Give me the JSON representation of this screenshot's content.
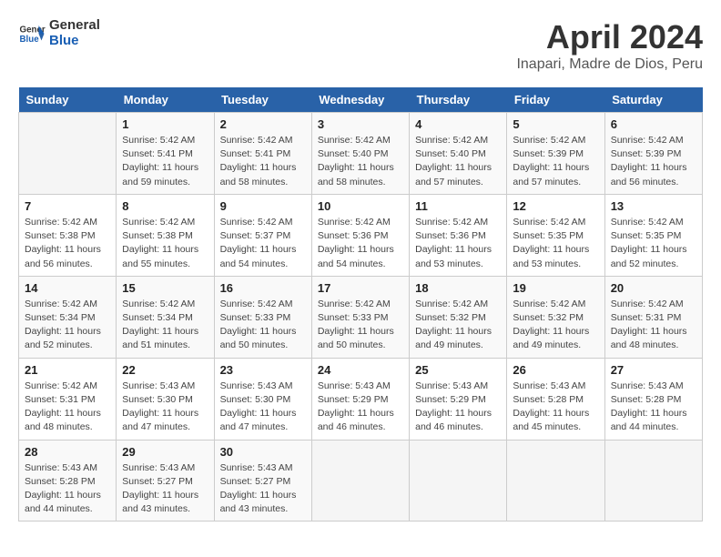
{
  "header": {
    "logo_line1": "General",
    "logo_line2": "Blue",
    "title": "April 2024",
    "subtitle": "Inapari, Madre de Dios, Peru"
  },
  "calendar": {
    "days_of_week": [
      "Sunday",
      "Monday",
      "Tuesday",
      "Wednesday",
      "Thursday",
      "Friday",
      "Saturday"
    ],
    "weeks": [
      [
        {
          "day": "",
          "info": ""
        },
        {
          "day": "1",
          "info": "Sunrise: 5:42 AM\nSunset: 5:41 PM\nDaylight: 11 hours\nand 59 minutes."
        },
        {
          "day": "2",
          "info": "Sunrise: 5:42 AM\nSunset: 5:41 PM\nDaylight: 11 hours\nand 58 minutes."
        },
        {
          "day": "3",
          "info": "Sunrise: 5:42 AM\nSunset: 5:40 PM\nDaylight: 11 hours\nand 58 minutes."
        },
        {
          "day": "4",
          "info": "Sunrise: 5:42 AM\nSunset: 5:40 PM\nDaylight: 11 hours\nand 57 minutes."
        },
        {
          "day": "5",
          "info": "Sunrise: 5:42 AM\nSunset: 5:39 PM\nDaylight: 11 hours\nand 57 minutes."
        },
        {
          "day": "6",
          "info": "Sunrise: 5:42 AM\nSunset: 5:39 PM\nDaylight: 11 hours\nand 56 minutes."
        }
      ],
      [
        {
          "day": "7",
          "info": "Sunrise: 5:42 AM\nSunset: 5:38 PM\nDaylight: 11 hours\nand 56 minutes."
        },
        {
          "day": "8",
          "info": "Sunrise: 5:42 AM\nSunset: 5:38 PM\nDaylight: 11 hours\nand 55 minutes."
        },
        {
          "day": "9",
          "info": "Sunrise: 5:42 AM\nSunset: 5:37 PM\nDaylight: 11 hours\nand 54 minutes."
        },
        {
          "day": "10",
          "info": "Sunrise: 5:42 AM\nSunset: 5:36 PM\nDaylight: 11 hours\nand 54 minutes."
        },
        {
          "day": "11",
          "info": "Sunrise: 5:42 AM\nSunset: 5:36 PM\nDaylight: 11 hours\nand 53 minutes."
        },
        {
          "day": "12",
          "info": "Sunrise: 5:42 AM\nSunset: 5:35 PM\nDaylight: 11 hours\nand 53 minutes."
        },
        {
          "day": "13",
          "info": "Sunrise: 5:42 AM\nSunset: 5:35 PM\nDaylight: 11 hours\nand 52 minutes."
        }
      ],
      [
        {
          "day": "14",
          "info": "Sunrise: 5:42 AM\nSunset: 5:34 PM\nDaylight: 11 hours\nand 52 minutes."
        },
        {
          "day": "15",
          "info": "Sunrise: 5:42 AM\nSunset: 5:34 PM\nDaylight: 11 hours\nand 51 minutes."
        },
        {
          "day": "16",
          "info": "Sunrise: 5:42 AM\nSunset: 5:33 PM\nDaylight: 11 hours\nand 50 minutes."
        },
        {
          "day": "17",
          "info": "Sunrise: 5:42 AM\nSunset: 5:33 PM\nDaylight: 11 hours\nand 50 minutes."
        },
        {
          "day": "18",
          "info": "Sunrise: 5:42 AM\nSunset: 5:32 PM\nDaylight: 11 hours\nand 49 minutes."
        },
        {
          "day": "19",
          "info": "Sunrise: 5:42 AM\nSunset: 5:32 PM\nDaylight: 11 hours\nand 49 minutes."
        },
        {
          "day": "20",
          "info": "Sunrise: 5:42 AM\nSunset: 5:31 PM\nDaylight: 11 hours\nand 48 minutes."
        }
      ],
      [
        {
          "day": "21",
          "info": "Sunrise: 5:42 AM\nSunset: 5:31 PM\nDaylight: 11 hours\nand 48 minutes."
        },
        {
          "day": "22",
          "info": "Sunrise: 5:43 AM\nSunset: 5:30 PM\nDaylight: 11 hours\nand 47 minutes."
        },
        {
          "day": "23",
          "info": "Sunrise: 5:43 AM\nSunset: 5:30 PM\nDaylight: 11 hours\nand 47 minutes."
        },
        {
          "day": "24",
          "info": "Sunrise: 5:43 AM\nSunset: 5:29 PM\nDaylight: 11 hours\nand 46 minutes."
        },
        {
          "day": "25",
          "info": "Sunrise: 5:43 AM\nSunset: 5:29 PM\nDaylight: 11 hours\nand 46 minutes."
        },
        {
          "day": "26",
          "info": "Sunrise: 5:43 AM\nSunset: 5:28 PM\nDaylight: 11 hours\nand 45 minutes."
        },
        {
          "day": "27",
          "info": "Sunrise: 5:43 AM\nSunset: 5:28 PM\nDaylight: 11 hours\nand 44 minutes."
        }
      ],
      [
        {
          "day": "28",
          "info": "Sunrise: 5:43 AM\nSunset: 5:28 PM\nDaylight: 11 hours\nand 44 minutes."
        },
        {
          "day": "29",
          "info": "Sunrise: 5:43 AM\nSunset: 5:27 PM\nDaylight: 11 hours\nand 43 minutes."
        },
        {
          "day": "30",
          "info": "Sunrise: 5:43 AM\nSunset: 5:27 PM\nDaylight: 11 hours\nand 43 minutes."
        },
        {
          "day": "",
          "info": ""
        },
        {
          "day": "",
          "info": ""
        },
        {
          "day": "",
          "info": ""
        },
        {
          "day": "",
          "info": ""
        }
      ]
    ]
  }
}
